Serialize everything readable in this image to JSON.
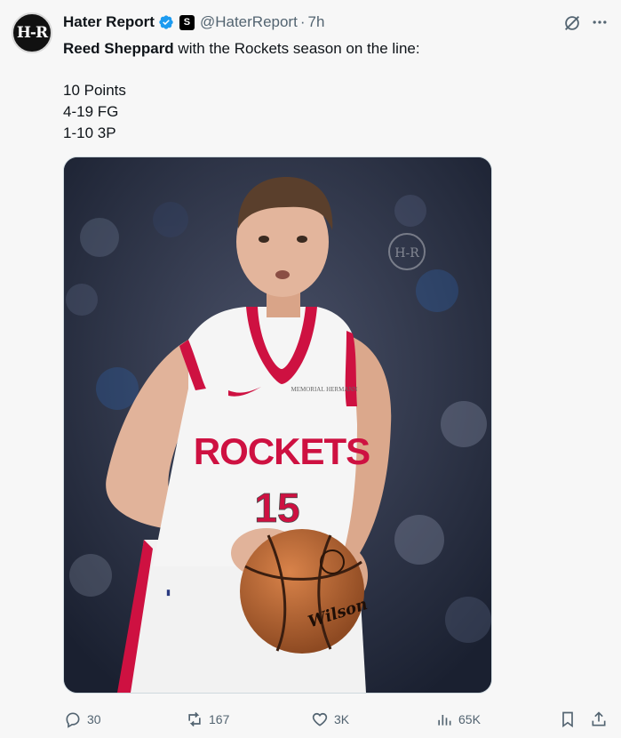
{
  "author": {
    "avatar_text": "H-R",
    "name": "Hater Report",
    "affiliate_badge": "S",
    "handle": "@HaterReport",
    "separator": "·",
    "time": "7h"
  },
  "tweet": {
    "player": "Reed Sheppard",
    "text_rest": " with the Rockets season on the line:",
    "stats": [
      "10 Points",
      "4-19 FG",
      "1-10 3P"
    ]
  },
  "media": {
    "jersey_team": "ROCKETS",
    "jersey_number": "15",
    "sponsor_patch": "MEMORIAL HERMANN",
    "ball_brand": "Wilson",
    "watermark": "H-R"
  },
  "actions": {
    "replies": "30",
    "reposts": "167",
    "likes": "3K",
    "views": "65K"
  },
  "icons": [
    "verified-icon",
    "grok-icon",
    "more-icon",
    "reply-icon",
    "repost-icon",
    "like-icon",
    "views-icon",
    "bookmark-icon",
    "share-icon"
  ],
  "colors": {
    "verified": "#1d9bf0",
    "text": "#0f1419",
    "muted": "#536471",
    "jersey_red": "#ce1141"
  }
}
